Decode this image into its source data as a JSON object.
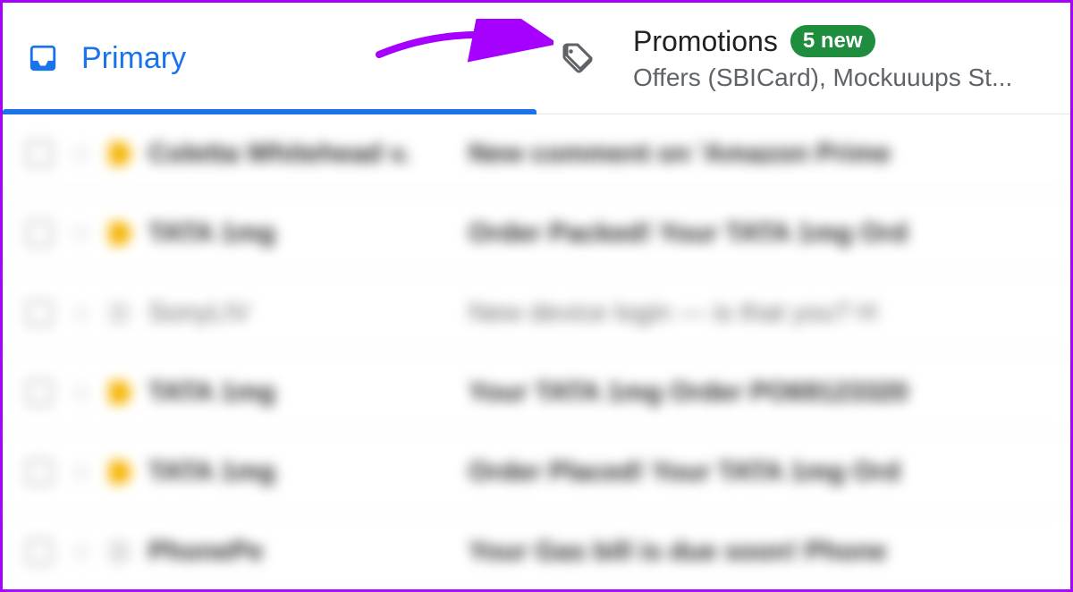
{
  "tabs": {
    "primary": {
      "label": "Primary"
    },
    "promotions": {
      "label": "Promotions",
      "badge": "5 new",
      "subtitle": "Offers (SBICard), Mockuuups St..."
    }
  },
  "annotation": {
    "color": "#a600ff"
  },
  "emails": [
    {
      "sender": "Coletta Whitehead v.",
      "subject": "New comment on 'Amazon Prime",
      "important": true,
      "read": false
    },
    {
      "sender": "TATA 1mg",
      "subject": "Order Packed! Your TATA 1mg Ord",
      "important": true,
      "read": false
    },
    {
      "sender": "SonyLIV",
      "subject": "New device login — is that you? H",
      "important": false,
      "read": true
    },
    {
      "sender": "TATA 1mg",
      "subject": "Your TATA 1mg Order PO69123320",
      "important": true,
      "read": false
    },
    {
      "sender": "TATA 1mg",
      "subject": "Order Placed! Your TATA 1mg Ord",
      "important": true,
      "read": false
    },
    {
      "sender": "PhonePe",
      "subject": "Your Gas bill is due soon! Phone",
      "important": false,
      "read": false
    }
  ]
}
